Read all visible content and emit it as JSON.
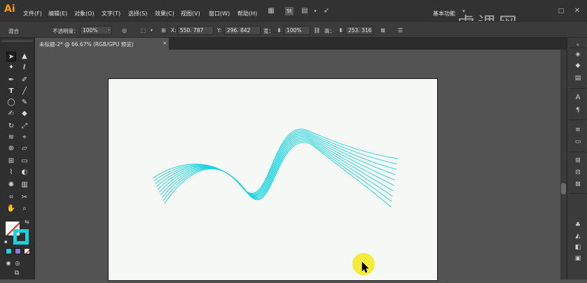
{
  "app": {
    "logo": "Ai"
  },
  "menu": [
    {
      "key": "file",
      "label": "文件(F)"
    },
    {
      "key": "edit",
      "label": "编辑(E)"
    },
    {
      "key": "object",
      "label": "对象(O)"
    },
    {
      "key": "type",
      "label": "文字(T)"
    },
    {
      "key": "select",
      "label": "选择(S)"
    },
    {
      "key": "effect",
      "label": "效果(C)"
    },
    {
      "key": "view",
      "label": "视图(V)"
    },
    {
      "key": "window",
      "label": "窗口(W)"
    },
    {
      "key": "help",
      "label": "帮助(H)"
    }
  ],
  "workspace": {
    "label": "基本功能"
  },
  "watermark": {
    "text": "虎课网"
  },
  "controlbar": {
    "blend_label": "混合",
    "opacity_label": "不透明度：",
    "opacity_value": "100%",
    "x_label": "X:",
    "x_value": "550. 787",
    "y_label": "Y:",
    "y_value": "296. 842",
    "w_label": "宽：",
    "w_value": "100%",
    "h_label": "高：",
    "h_value": "253. 316"
  },
  "document": {
    "tab_title": "未标题-2* @ 66.67% (RGB/GPU 预览)",
    "tab_close": "×"
  },
  "colors": {
    "accent": "#ff9a00",
    "stroke": "#19d3e0",
    "artboard": "#f5f8f5",
    "cursor_highlight": "#f3ec3a"
  },
  "icons": {
    "selection": "selection-tool-icon",
    "direct_selection": "direct-selection-tool-icon",
    "magic_wand": "magic-wand-tool-icon",
    "lasso": "lasso-tool-icon",
    "pen": "pen-tool-icon",
    "curvature": "curvature-tool-icon",
    "type": "type-tool-icon",
    "line": "line-segment-tool-icon",
    "ellipse": "ellipse-tool-icon",
    "paintbrush": "paintbrush-tool-icon",
    "shaper": "shaper-tool-icon",
    "eraser": "eraser-tool-icon",
    "rotate": "rotate-tool-icon",
    "scale": "scale-tool-icon",
    "width": "width-tool-icon",
    "free_transform": "free-transform-tool-icon",
    "shape_builder": "shape-builder-tool-icon",
    "perspective": "perspective-grid-tool-icon",
    "mesh": "mesh-tool-icon",
    "gradient": "gradient-tool-icon",
    "eyedropper": "eyedropper-tool-icon",
    "blend": "blend-tool-icon",
    "symbol_sprayer": "symbol-sprayer-tool-icon",
    "graph": "column-graph-tool-icon",
    "artboard": "artboard-tool-icon",
    "slice": "slice-tool-icon",
    "hand": "hand-tool-icon",
    "zoom": "zoom-tool-icon"
  }
}
